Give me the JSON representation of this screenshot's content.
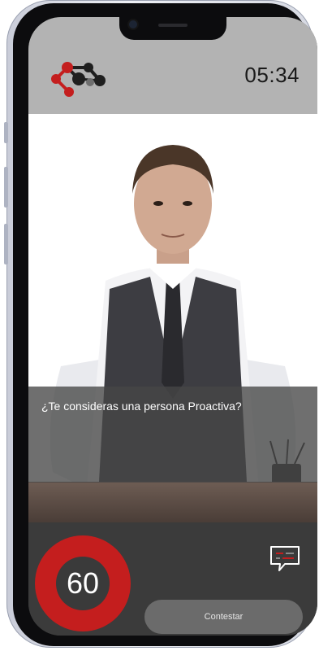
{
  "header": {
    "logo_icon": "network-molecule-logo",
    "timer": "05:34"
  },
  "interview": {
    "question": "¿Te consideras una persona Proactiva?"
  },
  "footer": {
    "countdown": "60",
    "chat_icon": "chat-bubble-icon",
    "answer_button_label": "Contestar"
  },
  "colors": {
    "header_bg": "#b3b3b3",
    "accent_red": "#c41e1e",
    "footer_bg": "#3b3b3b",
    "button_bg": "#6b6b6b"
  }
}
